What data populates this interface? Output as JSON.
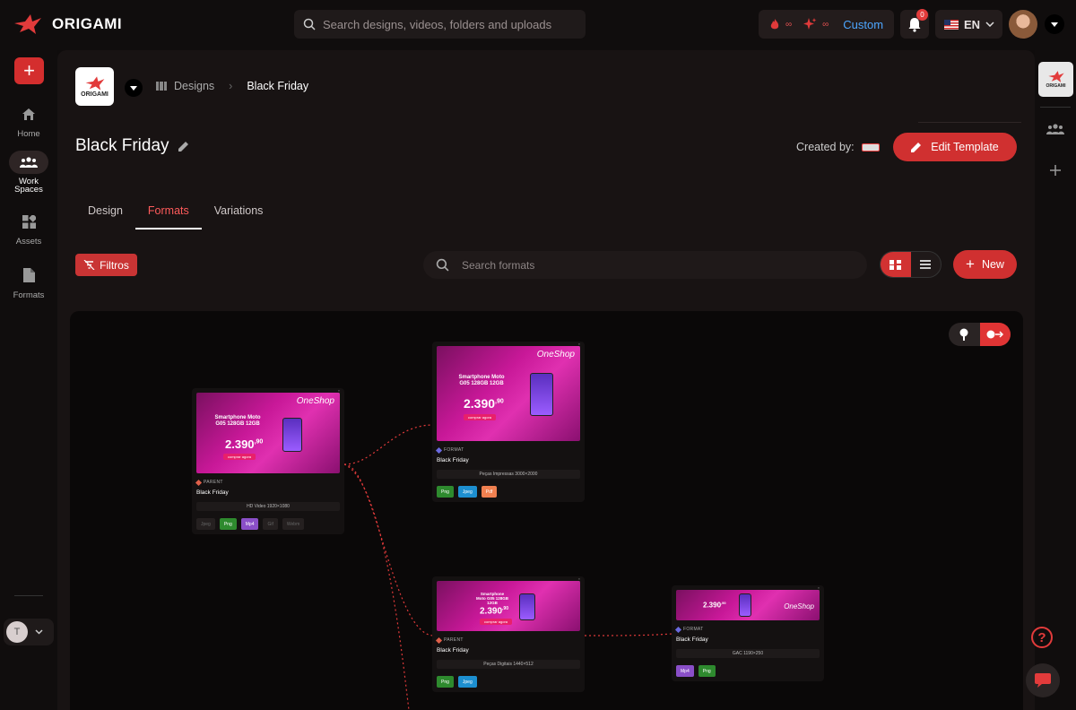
{
  "app": {
    "brand": "ORIGAMI"
  },
  "topbar": {
    "search_placeholder": "Search designs, videos, folders and uploads",
    "credits": [
      {
        "icon": "fire-icon",
        "value": "∞"
      },
      {
        "icon": "sparkles-icon",
        "value": "∞"
      }
    ],
    "plan": "Custom",
    "notifications": "0",
    "language": "EN"
  },
  "sidebar": {
    "items": [
      {
        "label": "Home",
        "icon": "home-icon"
      },
      {
        "label": "Work Spaces",
        "icon": "users-icon",
        "active": true
      },
      {
        "label": "Assets",
        "icon": "grid-icon"
      },
      {
        "label": "Formats",
        "icon": "file-icon"
      }
    ],
    "user_initial": "T"
  },
  "header": {
    "logo_text": "ORIGAMI",
    "breadcrumb": {
      "section": "Designs",
      "current": "Black Friday"
    },
    "title": "Black Friday",
    "created_by": "Created by:",
    "edit_label": "Edit Template"
  },
  "tabs": [
    {
      "label": "Design"
    },
    {
      "label": "Formats",
      "active": true
    },
    {
      "label": "Variations"
    }
  ],
  "toolbar": {
    "filter_label": "Filtros",
    "search_placeholder": "Search formats",
    "new_label": "New"
  },
  "thumb_text": {
    "brand": "OneShop",
    "product": "Smartphone Moto G05 128GB 12GB",
    "price": "2.390",
    "cents": ",90",
    "cta": "comprar agora"
  },
  "nodes": [
    {
      "type": "PARENT",
      "name": "Black Friday",
      "size": "HD Video 1920×1080",
      "chips": [
        {
          "label": "Jpeg",
          "on": false
        },
        {
          "label": "Png",
          "on": true
        },
        {
          "label": "Mp4",
          "on": true
        },
        {
          "label": "Gif",
          "on": false
        },
        {
          "label": "Webm",
          "on": false
        }
      ]
    },
    {
      "type": "FORMAT",
      "name": "Black Friday",
      "size": "Peças Impressas 3000×2000",
      "chips": [
        {
          "label": "Png",
          "on": true
        },
        {
          "label": "Jpeg",
          "on": true
        },
        {
          "label": "Pdf",
          "on": true
        }
      ]
    },
    {
      "type": "PARENT",
      "name": "Black Friday",
      "size": "Peças Digitais 1440×512",
      "chips": [
        {
          "label": "Png",
          "on": true
        },
        {
          "label": "Jpeg",
          "on": true
        }
      ]
    },
    {
      "type": "FORMAT",
      "name": "Black Friday",
      "size": "GAC 1190×250",
      "chips": [
        {
          "label": "Mp4",
          "on": true
        },
        {
          "label": "Png",
          "on": true
        }
      ]
    }
  ],
  "colors": {
    "accent": "#d03030",
    "parent": "#e0604a",
    "format": "#6a6ae0"
  }
}
